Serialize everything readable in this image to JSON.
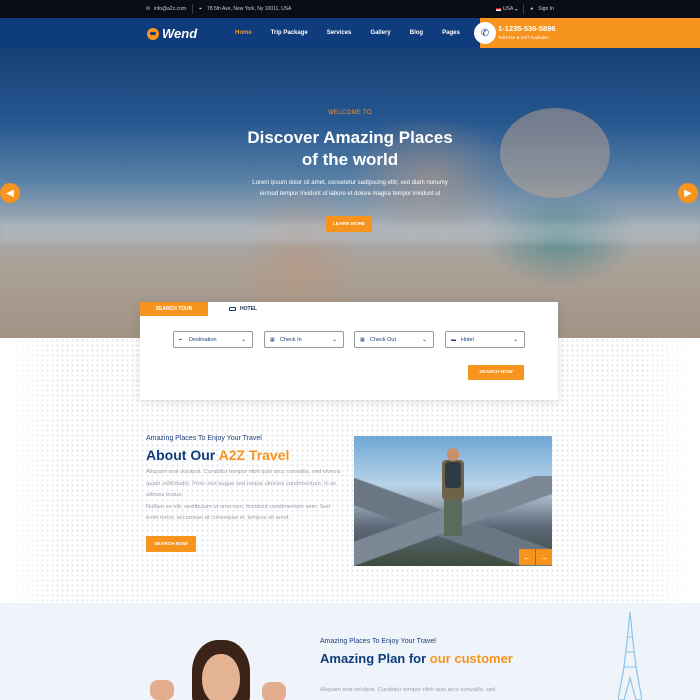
{
  "topbar": {
    "email": "info@a2z.com",
    "address": "78 5th Ave, New York, Ny 10011, USA",
    "language": "USA",
    "signin": "Sign In"
  },
  "nav": {
    "logo": "Wend",
    "menu": [
      "Home",
      "Trip Package",
      "Services",
      "Gallery",
      "Blog",
      "Pages"
    ],
    "active": "Home",
    "phone": "1-1235-536-5896",
    "phone_sub": "Toll Free & 24/7 Available"
  },
  "hero": {
    "welcome": "WELCOME TO",
    "title_line1": "Discover Amazing Places",
    "title_line2": "of the world",
    "desc_line1": "Lorem ipsum dolor sit amet, consetetur sadipscing elitr, sed diam nonumy",
    "desc_line2": "eirmod tempor invidunt ut labore et dolore magna tempor invidunt ut",
    "button": "LEARN MORE"
  },
  "search": {
    "tabs": [
      "SEARCH TOUR",
      "HOTEL"
    ],
    "fields": [
      "Destination",
      "Check In",
      "Check Out",
      "Hotel"
    ],
    "button": "SEARCH NOW"
  },
  "about": {
    "kicker": "Amazing Places To Enjoy Your Travel",
    "title_prefix": "About Our ",
    "title_highlight": "A2Z Travel",
    "para1": "Aliquam erat volutpat. Curabitur tempor nibh quis arcu convallis, sed viverra quam sollicitudin. Proin sed augue sed neque ultricies condimentum. In ac ultrices lectus.",
    "para2": "Nullam ex elit, vestibulum ut urna non, tincidunt condimentum sem. Sed enim tortor, accumsan at consequat et, tempus sit amet.",
    "button": "SEARCH NOW"
  },
  "plan": {
    "kicker": "Amazing Places To Enjoy Your Travel",
    "title_prefix": "Amazing Plan for ",
    "title_highlight": "our customer",
    "para": "Aliquam erat volutpat. Curabitur tempor nibh quis arcu convallis, sed"
  },
  "colors": {
    "accent": "#f7941d",
    "navy": "#0f3c7c"
  }
}
